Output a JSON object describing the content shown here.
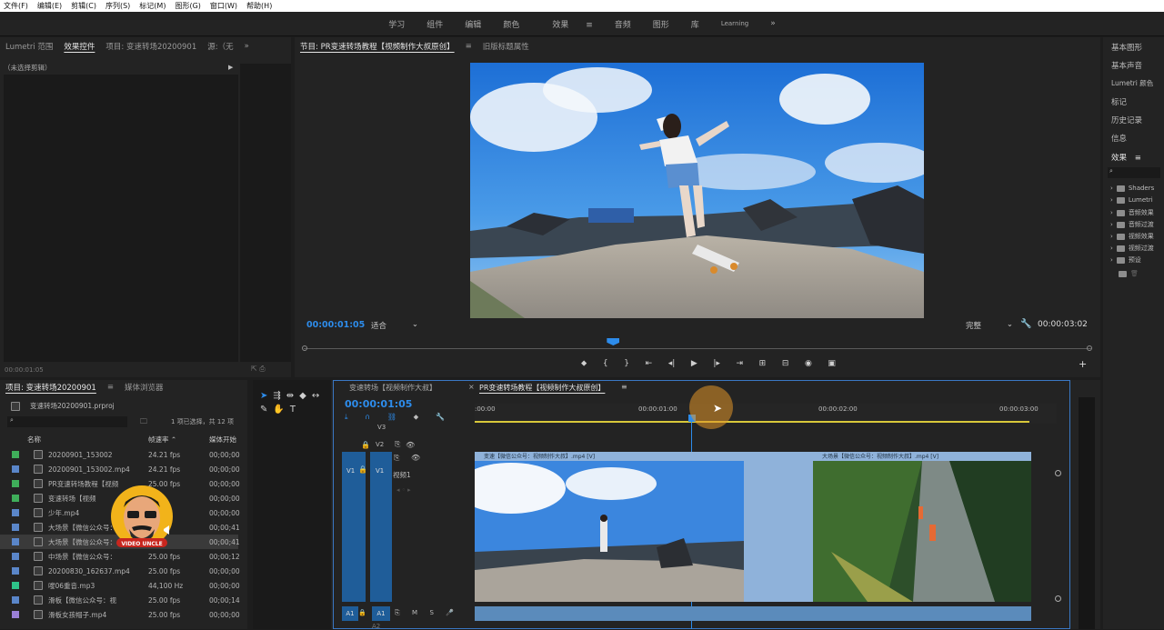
{
  "menu": [
    "文件(F)",
    "编辑(E)",
    "剪辑(C)",
    "序列(S)",
    "标记(M)",
    "图形(G)",
    "窗口(W)",
    "帮助(H)"
  ],
  "workspaces": {
    "items": [
      "学习",
      "组件",
      "编辑",
      "颜色",
      "效果",
      "音频",
      "图形",
      "库",
      "Learning"
    ],
    "active": "效果",
    "more": "»"
  },
  "source_panel": {
    "tabs": [
      "Lumetri 范围",
      "效果控件",
      "项目: 变速转场20200901",
      "源:（无"
    ],
    "active": "效果控件",
    "no_clip": "（未选择剪辑）",
    "timecode": "00:00:01:05"
  },
  "program": {
    "tabs": [
      "节目: PR变速转场教程【视频制作大叔原创】",
      "旧版标题属性"
    ],
    "timecode": "00:00:01:05",
    "fit": "适合",
    "quality": "完整",
    "duration": "00:00:03:02",
    "playhead_fraction": 0.393
  },
  "right_panel": {
    "items": [
      "基本图形",
      "基本声音",
      "Lumetri 颜色",
      "标记",
      "历史记录",
      "信息"
    ],
    "effects_title": "效果",
    "effects": [
      "Shaders",
      "Lumetri",
      "音频效果",
      "音频过渡",
      "视频效果",
      "视频过渡",
      "预设"
    ]
  },
  "project": {
    "tabs": [
      "项目: 变速转场20200901",
      "媒体浏览器"
    ],
    "file": "变速转场20200901.prproj",
    "selection": "1 项已选择，共 12 项",
    "columns": [
      "名称",
      "帧速率",
      "媒体开始"
    ],
    "rows": [
      {
        "name": "20200901_153002",
        "fps": "24.21 fps",
        "start": "00;00;00",
        "color": "#3fae5a",
        "kind": "seq"
      },
      {
        "name": "20200901_153002.mp4",
        "fps": "24.21 fps",
        "start": "00;00;00",
        "color": "#5a86c9",
        "kind": "clip"
      },
      {
        "name": "PR变速转场教程【视频",
        "fps": "25.00 fps",
        "start": "00;00;00",
        "color": "#3fae5a",
        "kind": "seq"
      },
      {
        "name": "变速转场【视频",
        "fps": "",
        "start": "00;00;00",
        "color": "#3fae5a",
        "kind": "seq"
      },
      {
        "name": "少年.mp4",
        "fps": "",
        "start": "00;00;00",
        "color": "#5a86c9",
        "kind": "clip"
      },
      {
        "name": "大场景【微信公众号：",
        "fps": "",
        "start": "00;00;41",
        "color": "#5a86c9",
        "kind": "clip"
      },
      {
        "name": "大场景【微信公众号：",
        "fps": "",
        "start": "00;00;41",
        "color": "#5a86c9",
        "kind": "clip"
      },
      {
        "name": "中场景【微信公众号：",
        "fps": "25.00 fps",
        "start": "00;00;12",
        "color": "#5a86c9",
        "kind": "clip"
      },
      {
        "name": "20200830_162637.mp4",
        "fps": "25.00 fps",
        "start": "00;00;00",
        "color": "#5a86c9",
        "kind": "clip"
      },
      {
        "name": "嗖06重音.mp3",
        "fps": "44,100 Hz",
        "start": "00;00;00",
        "color": "#2ec489",
        "kind": "audio"
      },
      {
        "name": "滑板【微信公众号：视",
        "fps": "25.00 fps",
        "start": "00;00;14",
        "color": "#5a86c9",
        "kind": "clip"
      },
      {
        "name": "滑板女孩帽子.mp4",
        "fps": "25.00 fps",
        "start": "00;00;00",
        "color": "#9a7fd6",
        "kind": "clip"
      }
    ]
  },
  "timeline": {
    "tabs": [
      "变速转场【视频制作大叔】",
      "PR变速转场教程【视频制作大叔原创】"
    ],
    "active_tab": "PR变速转场教程【视频制作大叔原创】",
    "timecode": "00:00:01:05",
    "ruler": [
      ":00:00",
      "00:00:01:00",
      "00:00:02:00",
      "00:00:03:00"
    ],
    "tracks": [
      "V3",
      "V2",
      "V1",
      "A1",
      "A2"
    ],
    "track_name": "视频1",
    "src_v1": "V1",
    "src_a1": "A1",
    "clip1_label": "变速【微信公众号：视频制作大叔】.mp4 [V]",
    "clip2_label": "大场景【微信公众号：视频制作大叔】.mp4 [V]"
  },
  "badge": {
    "text": "VIDEO UNCLE"
  }
}
